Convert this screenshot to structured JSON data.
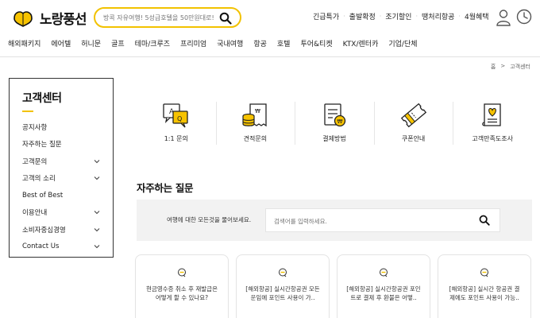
{
  "header": {
    "logo_text": "노랑풍선",
    "search_placeholder": "방콕 자유여행! 5성급호텔을 50만원대로!",
    "top_links": [
      "긴급특가",
      "출발확정",
      "조기할인",
      "땡처리항공",
      "4월혜택"
    ]
  },
  "nav": {
    "items": [
      "해외패키지",
      "에어텔",
      "허니문",
      "골프",
      "테마/크루즈",
      "프리미엄",
      "국내여행",
      "항공",
      "호텔",
      "투어&티켓",
      "KTX/렌터카",
      "기업/단체"
    ]
  },
  "breadcrumb": {
    "home": "홈",
    "separator": ">",
    "current": "고객센터"
  },
  "sidebar": {
    "title": "고객센터",
    "items": [
      {
        "label": "공지사항",
        "has_children": false
      },
      {
        "label": "자주하는 질문",
        "has_children": false
      },
      {
        "label": "고객문의",
        "has_children": true
      },
      {
        "label": "고객의 소리",
        "has_children": true
      },
      {
        "label": "Best of Best",
        "has_children": false
      },
      {
        "label": "이용안내",
        "has_children": true
      },
      {
        "label": "소비자중심경영",
        "has_children": true
      },
      {
        "label": "Contact Us",
        "has_children": true
      }
    ]
  },
  "categories": [
    {
      "label": "1:1 문의",
      "icon": "chat-qa-icon"
    },
    {
      "label": "견적문의",
      "icon": "coins-receipt-icon"
    },
    {
      "label": "결제방법",
      "icon": "payment-doc-icon"
    },
    {
      "label": "쿠폰안내",
      "icon": "coupon-icon"
    },
    {
      "label": "고객만족도조사",
      "icon": "survey-heart-icon"
    }
  ],
  "faq": {
    "title": "자주하는 질문",
    "search_label": "여행에 대한 모든것을 물어보세요.",
    "search_placeholder": "검색어를 입력하세요.",
    "cards": [
      {
        "line1": "현금영수증 취소 후 재발급은",
        "line2": "어떻게 할 수 있나요?"
      },
      {
        "line1": "[해외항공] 실시간항공권 모든",
        "line2": "운임에 포인트 사용이 가.."
      },
      {
        "line1": "[해외항공] 실시간항공권 포인",
        "line2": "트로 결제 후 환불은 어떻.."
      },
      {
        "line1": "[해외항공] 실시간 항공권 결",
        "line2": "제에도 포인트 사용이 가능.."
      }
    ]
  },
  "colors": {
    "accent": "#f2c200",
    "border": "#333333",
    "panel": "#f2f2f2"
  }
}
